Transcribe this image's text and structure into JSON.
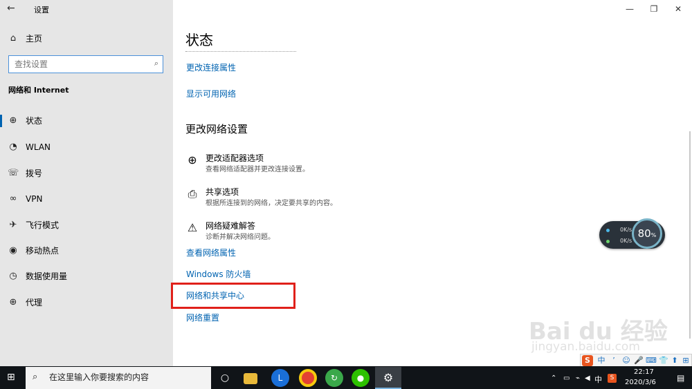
{
  "window": {
    "title": "设置",
    "back_icon": "back-arrow-icon",
    "controls": [
      "minimize-icon",
      "restore-icon",
      "close-icon"
    ]
  },
  "sidebar": {
    "home_label": "主页",
    "search_placeholder": "查找设置",
    "section_title": "网络和 Internet",
    "items": [
      {
        "label": "状态",
        "icon": "status-globe-icon",
        "active": true
      },
      {
        "label": "WLAN",
        "icon": "wifi-icon",
        "active": false
      },
      {
        "label": "拨号",
        "icon": "dialup-icon",
        "active": false
      },
      {
        "label": "VPN",
        "icon": "vpn-icon",
        "active": false
      },
      {
        "label": "飞行模式",
        "icon": "airplane-icon",
        "active": false
      },
      {
        "label": "移动热点",
        "icon": "hotspot-icon",
        "active": false
      },
      {
        "label": "数据使用量",
        "icon": "data-usage-icon",
        "active": false
      },
      {
        "label": "代理",
        "icon": "proxy-globe-icon",
        "active": false
      }
    ]
  },
  "main": {
    "title": "状态",
    "links_top": [
      "更改连接属性",
      "显示可用网络"
    ],
    "section_title": "更改网络设置",
    "options": [
      {
        "title": "更改适配器选项",
        "desc": "查看网络适配器并更改连接设置。",
        "icon": "adapter-icon"
      },
      {
        "title": "共享选项",
        "desc": "根据所连接到的网络，决定要共享的内容。",
        "icon": "sharing-icon"
      },
      {
        "title": "网络疑难解答",
        "desc": "诊断并解决网络问题。",
        "icon": "warning-icon"
      }
    ],
    "links_bottom": [
      "查看网络属性",
      "Windows 防火墙",
      "网络和共享中心",
      "网络重置"
    ],
    "highlight_color": "#e0201a"
  },
  "speed_widget": {
    "up": "0K/s",
    "down": "0K/s",
    "percent": "80",
    "percent_suffix": "%"
  },
  "ime_toolbar": {
    "lang": "中",
    "items": [
      "中",
      "ʼ",
      "☺",
      "🎤",
      "⌨",
      "👕",
      "⬆",
      "⊞"
    ]
  },
  "taskbar": {
    "search_placeholder": "在这里输入你要搜索的内容",
    "apps": [
      "start-icon",
      "search-icon",
      "cortana-icon",
      "file-explorer-icon",
      "l-app-icon",
      "chrome-icon",
      "refresh-app-icon",
      "wechat-icon",
      "settings-icon"
    ],
    "tray": {
      "ime_lang": "中",
      "time": "22:17",
      "date": "2020/3/6"
    }
  },
  "watermark": {
    "line1": "Bai du 经验",
    "line2": "jingyan.baidu.com"
  },
  "colors": {
    "accent": "#0063b1",
    "sidebar_bg": "#e6e6e6",
    "taskbar_bg": "#101418"
  }
}
